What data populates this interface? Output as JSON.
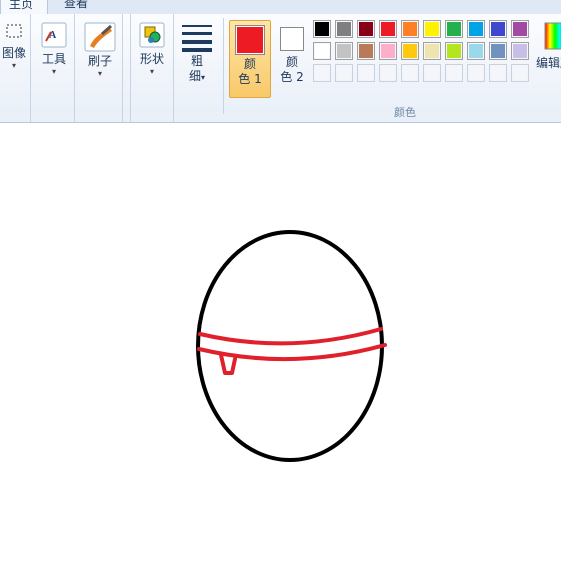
{
  "tabs": {
    "home": "主页",
    "view": "查看"
  },
  "ribbon": {
    "image_label": "图像",
    "tools_label": "工具",
    "brushes_label": "刷子",
    "shapes_label": "形状",
    "size_label_1": "粗",
    "size_label_2": "细",
    "color1_label_1": "颜",
    "color1_label_2": "色 1",
    "color2_label_1": "颜",
    "color2_label_2": "色 2",
    "colors_group_caption": "颜色",
    "edit_colors_label": "编辑颜"
  },
  "palette": {
    "row1": [
      "#000000",
      "#7f7f7f",
      "#880015",
      "#ed1c24",
      "#ff7f27",
      "#fff200",
      "#22b14c",
      "#00a2e8",
      "#3f48cc",
      "#a349a4"
    ],
    "row2": [
      "#ffffff",
      "#c3c3c3",
      "#b97a57",
      "#ffaec9",
      "#ffc90e",
      "#efe4b0",
      "#b5e61d",
      "#99d9ea",
      "#7092be",
      "#c8bfe7"
    ],
    "row3_count": 10,
    "color1": "#ed1c24",
    "color2": "#ffffff"
  },
  "drawing": {
    "outline_color": "#000000",
    "stroke_color": "#e0202a"
  }
}
